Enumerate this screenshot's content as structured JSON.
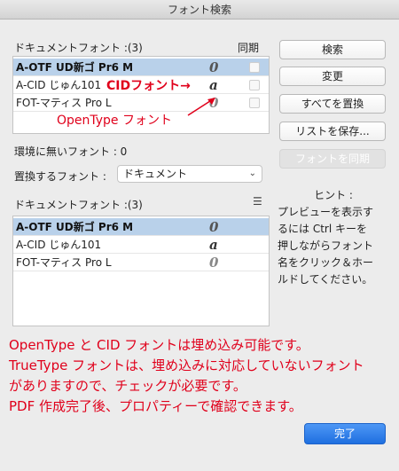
{
  "window": {
    "title": "フォント検索"
  },
  "upper_list": {
    "header": "ドキュメントフォント :(3)",
    "column_sync": "同期",
    "rows": [
      {
        "name": "A-OTF UD新ゴ Pr6 M",
        "glyph": "0",
        "selected": true
      },
      {
        "name": "A-CID じゅん101",
        "glyph": "a",
        "selected": false
      },
      {
        "name": "FOT-マティス Pro L",
        "glyph": "0",
        "selected": false
      }
    ]
  },
  "missing_fonts": "環境に無いフォント : 0",
  "replace": {
    "label": "置換するフォント :",
    "selected": "ドキュメント"
  },
  "lower_list": {
    "header": "ドキュメントフォント :(3)",
    "menu_icon": "list-icon",
    "rows": [
      {
        "name": "A-OTF UD新ゴ Pr6 M",
        "glyph": "0",
        "selected": true
      },
      {
        "name": "A-CID じゅん101",
        "glyph": "a",
        "selected": false
      },
      {
        "name": "FOT-マティス Pro L",
        "glyph": "0",
        "selected": false
      }
    ]
  },
  "buttons": {
    "search": "検索",
    "change": "変更",
    "replace_all": "すべてを置換",
    "save_list": "リストを保存...",
    "sync_fonts": "フォントを同期",
    "done": "完了"
  },
  "hint": {
    "title": "ヒント :",
    "lines": [
      "プレビューを表示す",
      "るには Ctrl キーを",
      "押しながらフォント",
      "名をクリック＆ホー",
      "ルドしてください。"
    ]
  },
  "annotations": {
    "cid": "CIDフォント",
    "opentype": "OpenType フォント",
    "notes": [
      "OpenType と CID フォントは埋め込み可能です。",
      "TrueType フォントは、埋め込みに対応していないフォント",
      "がありますので、チェックが必要です。",
      "PDF 作成完了後、プロパティーで確認できます。"
    ]
  },
  "colors": {
    "selection": "#b9d1ea",
    "annotation": "#e0001b",
    "primary": "#1f6fe0"
  }
}
